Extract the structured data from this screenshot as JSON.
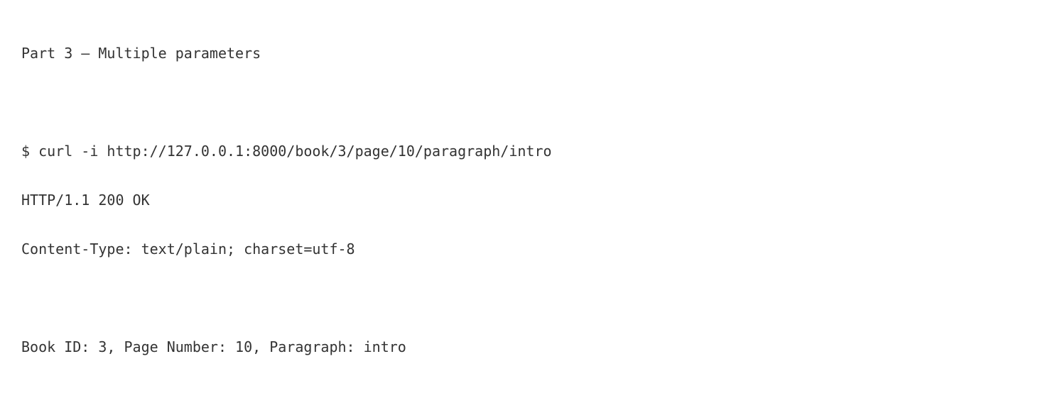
{
  "heading": "Part 3 — Multiple parameters",
  "command": "$ curl -i http://127.0.0.1:8000/book/3/page/10/paragraph/intro",
  "response": {
    "status_line": "HTTP/1.1 200 OK",
    "content_type_header": "Content-Type: text/plain; charset=utf-8",
    "body": "Book ID: 3, Page Number: 10, Paragraph: intro"
  }
}
